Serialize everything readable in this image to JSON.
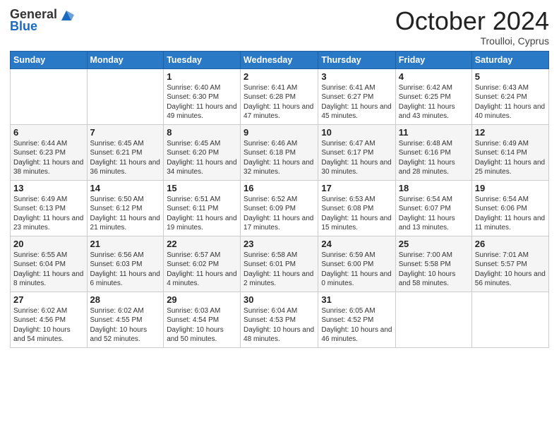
{
  "header": {
    "logo_general": "General",
    "logo_blue": "Blue",
    "month_title": "October 2024",
    "location": "Troulloi, Cyprus"
  },
  "days_of_week": [
    "Sunday",
    "Monday",
    "Tuesday",
    "Wednesday",
    "Thursday",
    "Friday",
    "Saturday"
  ],
  "weeks": [
    [
      {
        "day": "",
        "info": ""
      },
      {
        "day": "",
        "info": ""
      },
      {
        "day": "1",
        "info": "Sunrise: 6:40 AM\nSunset: 6:30 PM\nDaylight: 11 hours and 49 minutes."
      },
      {
        "day": "2",
        "info": "Sunrise: 6:41 AM\nSunset: 6:28 PM\nDaylight: 11 hours and 47 minutes."
      },
      {
        "day": "3",
        "info": "Sunrise: 6:41 AM\nSunset: 6:27 PM\nDaylight: 11 hours and 45 minutes."
      },
      {
        "day": "4",
        "info": "Sunrise: 6:42 AM\nSunset: 6:25 PM\nDaylight: 11 hours and 43 minutes."
      },
      {
        "day": "5",
        "info": "Sunrise: 6:43 AM\nSunset: 6:24 PM\nDaylight: 11 hours and 40 minutes."
      }
    ],
    [
      {
        "day": "6",
        "info": "Sunrise: 6:44 AM\nSunset: 6:23 PM\nDaylight: 11 hours and 38 minutes."
      },
      {
        "day": "7",
        "info": "Sunrise: 6:45 AM\nSunset: 6:21 PM\nDaylight: 11 hours and 36 minutes."
      },
      {
        "day": "8",
        "info": "Sunrise: 6:45 AM\nSunset: 6:20 PM\nDaylight: 11 hours and 34 minutes."
      },
      {
        "day": "9",
        "info": "Sunrise: 6:46 AM\nSunset: 6:18 PM\nDaylight: 11 hours and 32 minutes."
      },
      {
        "day": "10",
        "info": "Sunrise: 6:47 AM\nSunset: 6:17 PM\nDaylight: 11 hours and 30 minutes."
      },
      {
        "day": "11",
        "info": "Sunrise: 6:48 AM\nSunset: 6:16 PM\nDaylight: 11 hours and 28 minutes."
      },
      {
        "day": "12",
        "info": "Sunrise: 6:49 AM\nSunset: 6:14 PM\nDaylight: 11 hours and 25 minutes."
      }
    ],
    [
      {
        "day": "13",
        "info": "Sunrise: 6:49 AM\nSunset: 6:13 PM\nDaylight: 11 hours and 23 minutes."
      },
      {
        "day": "14",
        "info": "Sunrise: 6:50 AM\nSunset: 6:12 PM\nDaylight: 11 hours and 21 minutes."
      },
      {
        "day": "15",
        "info": "Sunrise: 6:51 AM\nSunset: 6:11 PM\nDaylight: 11 hours and 19 minutes."
      },
      {
        "day": "16",
        "info": "Sunrise: 6:52 AM\nSunset: 6:09 PM\nDaylight: 11 hours and 17 minutes."
      },
      {
        "day": "17",
        "info": "Sunrise: 6:53 AM\nSunset: 6:08 PM\nDaylight: 11 hours and 15 minutes."
      },
      {
        "day": "18",
        "info": "Sunrise: 6:54 AM\nSunset: 6:07 PM\nDaylight: 11 hours and 13 minutes."
      },
      {
        "day": "19",
        "info": "Sunrise: 6:54 AM\nSunset: 6:06 PM\nDaylight: 11 hours and 11 minutes."
      }
    ],
    [
      {
        "day": "20",
        "info": "Sunrise: 6:55 AM\nSunset: 6:04 PM\nDaylight: 11 hours and 8 minutes."
      },
      {
        "day": "21",
        "info": "Sunrise: 6:56 AM\nSunset: 6:03 PM\nDaylight: 11 hours and 6 minutes."
      },
      {
        "day": "22",
        "info": "Sunrise: 6:57 AM\nSunset: 6:02 PM\nDaylight: 11 hours and 4 minutes."
      },
      {
        "day": "23",
        "info": "Sunrise: 6:58 AM\nSunset: 6:01 PM\nDaylight: 11 hours and 2 minutes."
      },
      {
        "day": "24",
        "info": "Sunrise: 6:59 AM\nSunset: 6:00 PM\nDaylight: 11 hours and 0 minutes."
      },
      {
        "day": "25",
        "info": "Sunrise: 7:00 AM\nSunset: 5:58 PM\nDaylight: 10 hours and 58 minutes."
      },
      {
        "day": "26",
        "info": "Sunrise: 7:01 AM\nSunset: 5:57 PM\nDaylight: 10 hours and 56 minutes."
      }
    ],
    [
      {
        "day": "27",
        "info": "Sunrise: 6:02 AM\nSunset: 4:56 PM\nDaylight: 10 hours and 54 minutes."
      },
      {
        "day": "28",
        "info": "Sunrise: 6:02 AM\nSunset: 4:55 PM\nDaylight: 10 hours and 52 minutes."
      },
      {
        "day": "29",
        "info": "Sunrise: 6:03 AM\nSunset: 4:54 PM\nDaylight: 10 hours and 50 minutes."
      },
      {
        "day": "30",
        "info": "Sunrise: 6:04 AM\nSunset: 4:53 PM\nDaylight: 10 hours and 48 minutes."
      },
      {
        "day": "31",
        "info": "Sunrise: 6:05 AM\nSunset: 4:52 PM\nDaylight: 10 hours and 46 minutes."
      },
      {
        "day": "",
        "info": ""
      },
      {
        "day": "",
        "info": ""
      }
    ]
  ]
}
